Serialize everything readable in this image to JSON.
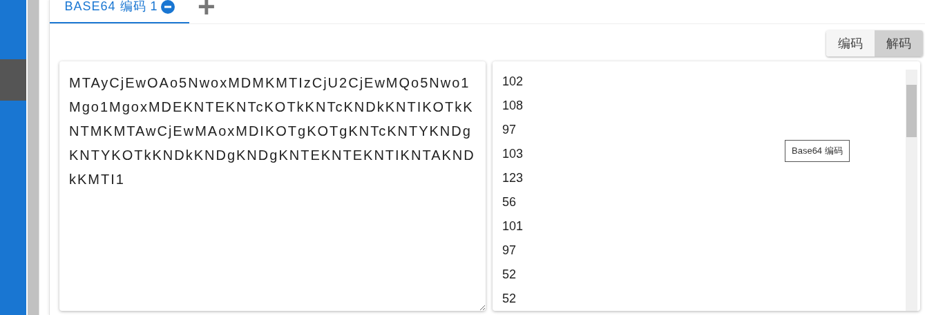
{
  "tabs": [
    {
      "label": "BASE64 编码 1",
      "selected": true,
      "closable": true
    }
  ],
  "add_tab": {
    "symbol": "+"
  },
  "mode_buttons": [
    {
      "label": "编码",
      "selected": false
    },
    {
      "label": "解码",
      "selected": true
    }
  ],
  "input": {
    "value": "MTAyCjEwOAo5NwoxMDMKMTIzCjU2CjEwMQo5Nwo1Mgo1MgoxMDEKNTEKNTcKOTkKNTcKNDkKNTIKOTkKNTMKMTAwCjEwMAoxMDIKOTgKOTgKNTcKNTYKNDgKNTYKOTkKNDkKNDgKNDgKNTEKNTEKNTIKNTAKNDkKMTI1"
  },
  "output": {
    "lines": [
      "102",
      "108",
      "97",
      "103",
      "123",
      "56",
      "101",
      "97",
      "52",
      "52"
    ]
  },
  "tooltip": {
    "text": "Base64 编码"
  }
}
